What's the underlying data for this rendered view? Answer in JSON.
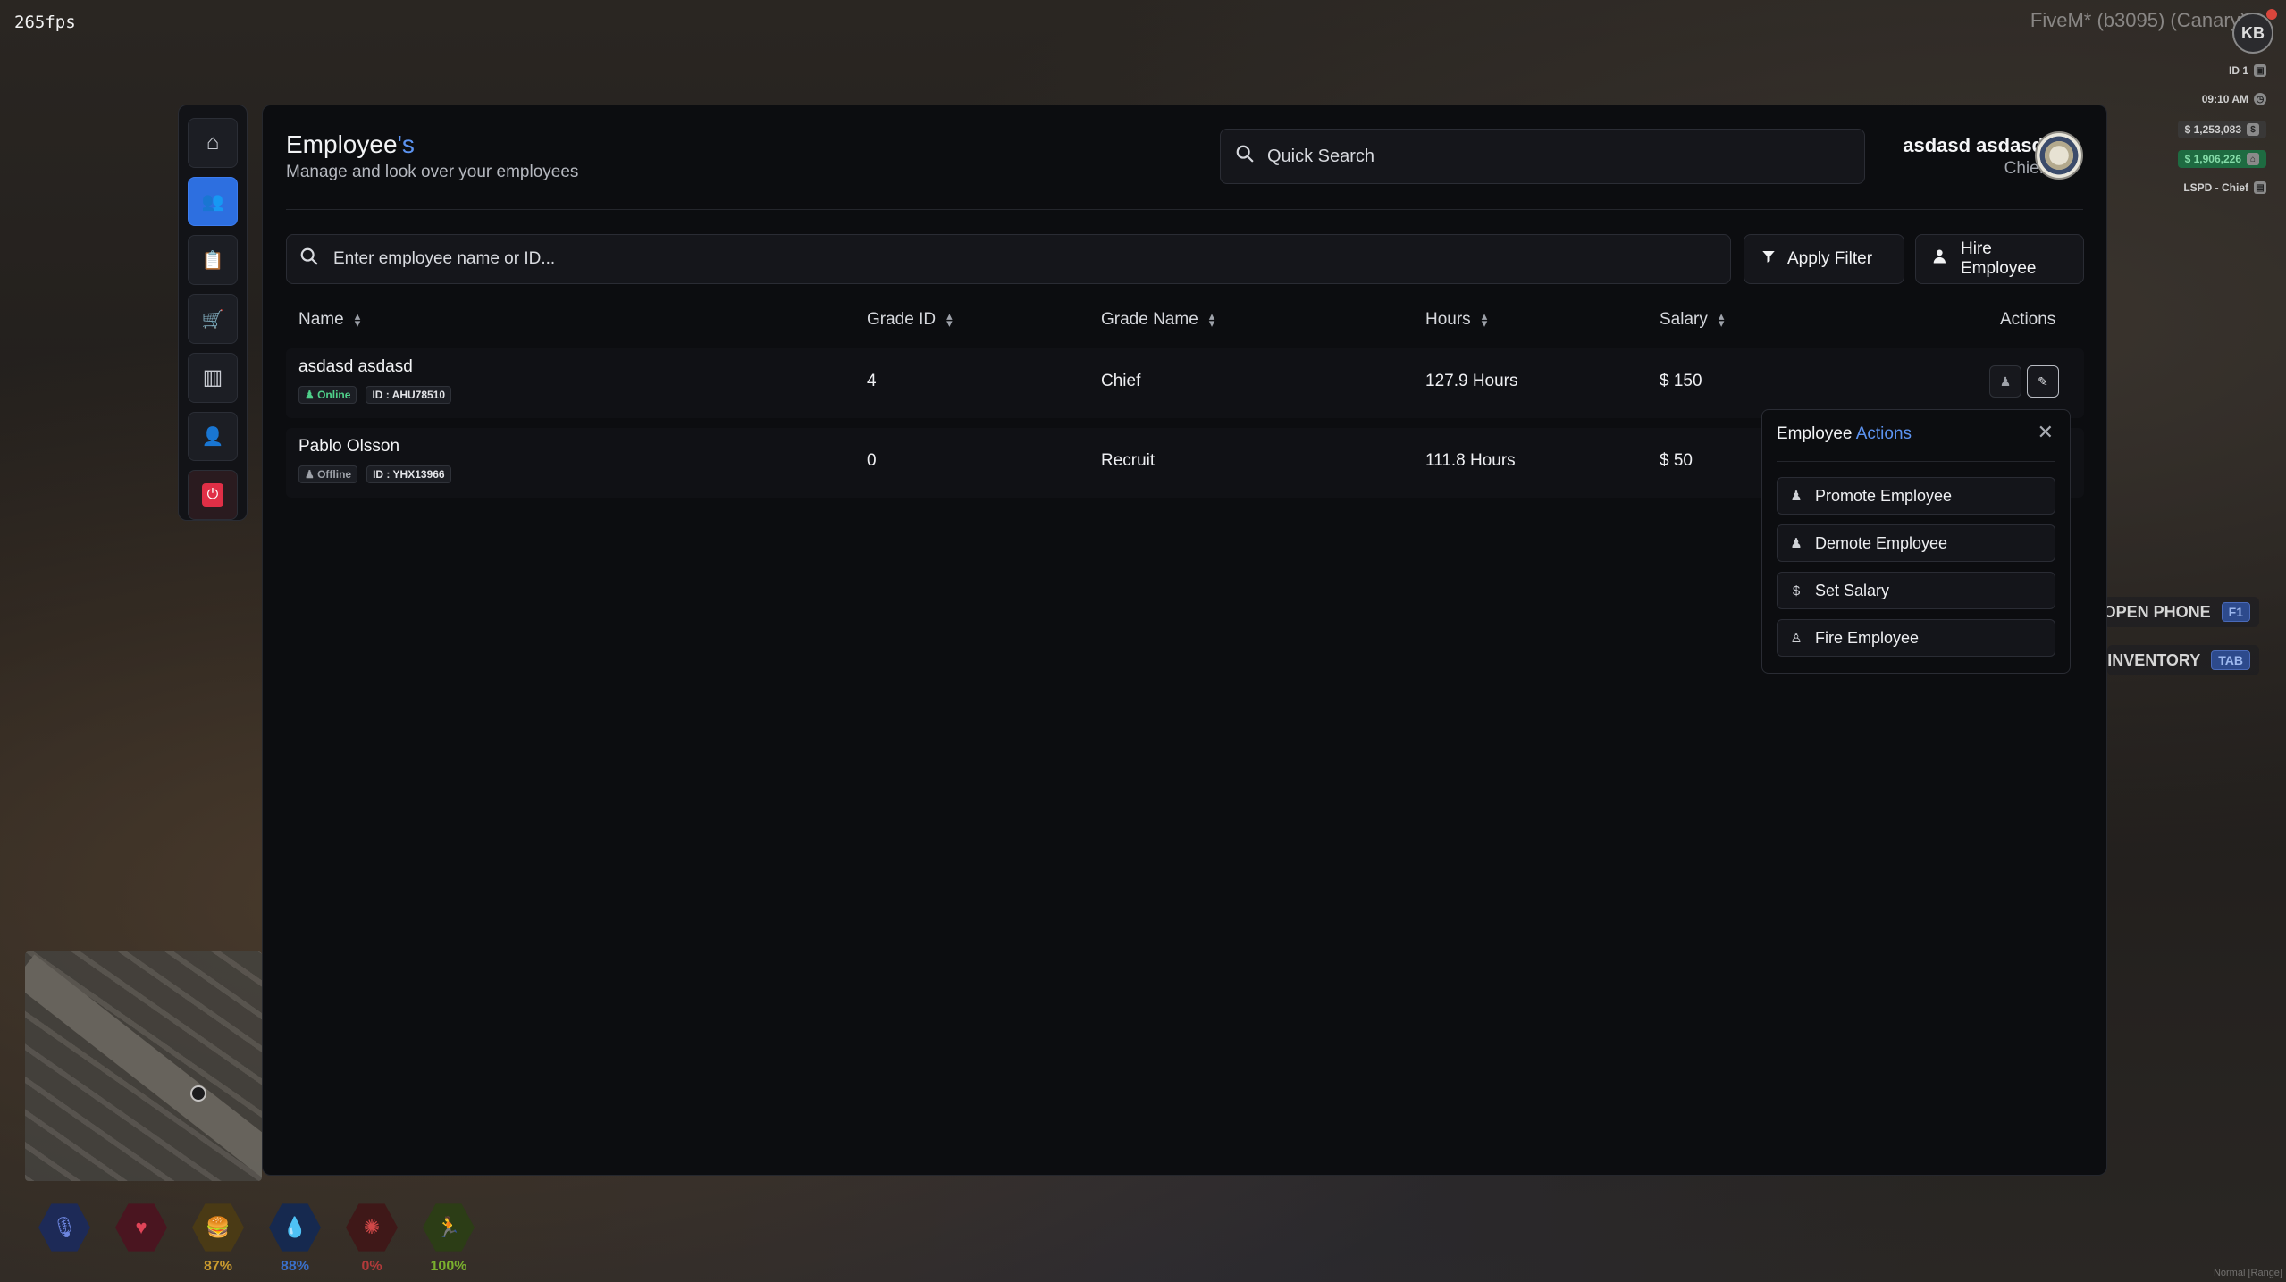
{
  "hud": {
    "fps": "265fps",
    "fivem": "FiveM* (b3095) (Canary)",
    "corner_badge": "KB",
    "right": {
      "id": "ID 1",
      "time": "09:10 AM",
      "cash": "$ 1,253,083",
      "bank": "$ 1,906,226",
      "job": "LSPD - Chief"
    },
    "keyhints": [
      {
        "label": "OPEN PHONE",
        "key": "F1"
      },
      {
        "label": "INVENTORY",
        "key": "TAB"
      }
    ],
    "stats": [
      {
        "name": "voice",
        "value": "",
        "color": "#3a55b5"
      },
      {
        "name": "health",
        "value": "",
        "color": "#c4303e"
      },
      {
        "name": "hunger",
        "value": "87%",
        "color": "#c99a2e"
      },
      {
        "name": "thirst",
        "value": "88%",
        "color": "#3a6fc8"
      },
      {
        "name": "stress",
        "value": "0%",
        "color": "#b23a3a"
      },
      {
        "name": "stamina",
        "value": "100%",
        "color": "#7ab02e"
      }
    ],
    "bottom_right": "Normal [Range]"
  },
  "sidebar": {
    "items": [
      {
        "name": "home",
        "icon": "⌂"
      },
      {
        "name": "employees",
        "icon": "👥"
      },
      {
        "name": "clipboard",
        "icon": "📋"
      },
      {
        "name": "cart",
        "icon": "🛒"
      },
      {
        "name": "lockers",
        "icon": "▥"
      },
      {
        "name": "profile",
        "icon": "👤"
      },
      {
        "name": "exit",
        "icon": "⏻"
      }
    ]
  },
  "header": {
    "title_main": "Employee",
    "title_accent": "'s",
    "subtitle": "Manage and look over your employees",
    "quick_search": "Quick Search",
    "user_name": "asdasd asdasd",
    "user_role": "Chief"
  },
  "toolbar": {
    "search_placeholder": "Enter employee name or ID...",
    "apply_filter": "Apply Filter",
    "hire_employee": "Hire Employee"
  },
  "table": {
    "columns": [
      "Name",
      "Grade ID",
      "Grade Name",
      "Hours",
      "Salary",
      "Actions"
    ],
    "rows": [
      {
        "name": "asdasd asdasd",
        "status": "Online",
        "id": "ID : AHU78510",
        "grade_id": "4",
        "grade_name": "Chief",
        "hours": "127.9 Hours",
        "salary": "$ 150"
      },
      {
        "name": "Pablo Olsson",
        "status": "Offline",
        "id": "ID : YHX13966",
        "grade_id": "0",
        "grade_name": "Recruit",
        "hours": "111.8 Hours",
        "salary": "$ 50"
      }
    ]
  },
  "popup": {
    "title_main": "Employee",
    "title_accent": "Actions",
    "items": [
      "Promote Employee",
      "Demote Employee",
      "Set Salary",
      "Fire Employee"
    ]
  },
  "colors": {
    "accent": "#2d6fe0",
    "online": "#4fd08a",
    "panel": "#0c0d10"
  }
}
